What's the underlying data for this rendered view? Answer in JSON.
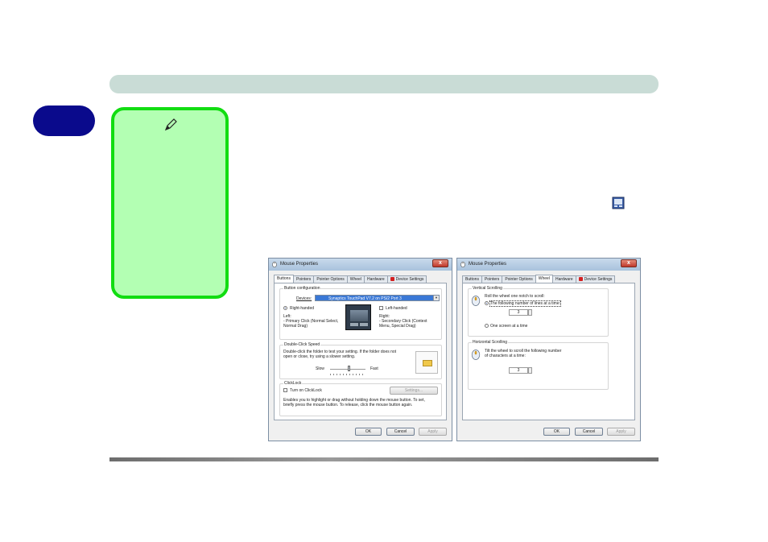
{
  "left_dialog": {
    "title": "Mouse Properties",
    "close": "x",
    "tabs": [
      "Buttons",
      "Pointers",
      "Pointer Options",
      "Wheel",
      "Hardware",
      "Device Settings"
    ],
    "button_configuration": {
      "title": "Button configuration",
      "devices_label": "Devices:",
      "devices_value": "Synaptics TouchPad V7.2 on PS/2 Port 3",
      "right_handed": "Right-handed",
      "left_handed": "Left-handed",
      "left_desc_1": "Left:",
      "left_desc_2": "- Primary Click (Normal Select,",
      "left_desc_3": "Normal Drag)",
      "right_desc_1": "Right:",
      "right_desc_2": "- Secondary Click (Context",
      "right_desc_3": "Menu, Special Drag)"
    },
    "double_click": {
      "title": "Double-Click Speed",
      "desc_1": "Double-click the folder to test your setting.  If the folder does not",
      "desc_2": "open or close, try using a slower setting.",
      "slow": "Slow",
      "fast": "Fast",
      "speed_level": 0.55
    },
    "clicklock": {
      "title": "ClickLock",
      "checkbox": "Turn on ClickLock",
      "settings": "Settings...",
      "desc_1": "Enables you to highlight or drag without holding down the mouse button.  To set,",
      "desc_2": "briefly press the mouse button.  To release, click the mouse button again."
    },
    "buttons": {
      "ok": "OK",
      "cancel": "Cancel",
      "apply": "Apply"
    }
  },
  "right_dialog": {
    "title": "Mouse Properties",
    "close": "x",
    "tabs": [
      "Buttons",
      "Pointers",
      "Pointer Options",
      "Wheel",
      "Hardware",
      "Device Settings"
    ],
    "vertical": {
      "title": "Vertical Scrolling",
      "desc": "Roll the wheel one notch to scroll:",
      "option_lines": "The following number of lines at a time:",
      "lines_value": "3",
      "option_screen": "One screen at a time"
    },
    "horizontal": {
      "title": "Horizontal Scrolling",
      "desc_1": "Tilt the wheel to scroll the following number",
      "desc_2": "of characters at a time:",
      "chars_value": "3"
    },
    "buttons": {
      "ok": "OK",
      "cancel": "Cancel",
      "apply": "Apply"
    }
  }
}
